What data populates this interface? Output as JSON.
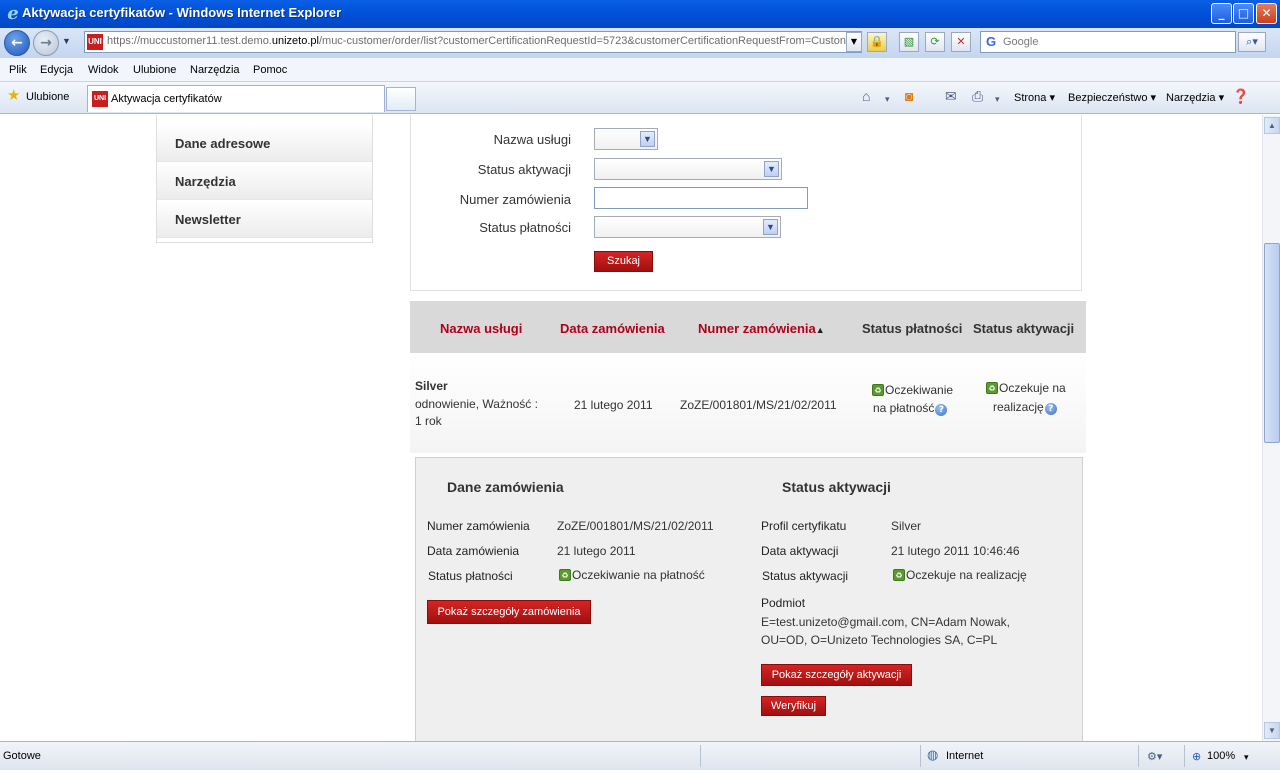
{
  "window": {
    "title": "Aktywacja certyfikatów - Windows Internet Explorer",
    "minimize": "_",
    "maximize": "□",
    "close": "✕"
  },
  "navbar": {
    "back_icon": "←",
    "forward_icon": "→",
    "url_prefix": "https://muccustomer11.test.demo.",
    "url_domain": "unizeto.pl",
    "url_rest": "/muc-customer/order/list?customerCertificationRequestId=5723&customerCertificationRequestFrom=Custon",
    "favicon": "UNI",
    "search_placeholder": "Google",
    "search_logo": "G"
  },
  "menu": [
    "Plik",
    "Edycja",
    "Widok",
    "Ulubione",
    "Narzędzia",
    "Pomoc"
  ],
  "tabs": {
    "favorites": "Ulubione",
    "active_tab": "Aktywacja certyfikatów",
    "commands": [
      "Strona ▾",
      "Bezpieczeństwo ▾",
      "Narzędzia ▾"
    ]
  },
  "sidebar": {
    "items": [
      "Dane adresowe",
      "Narzędzia",
      "Newsletter"
    ]
  },
  "filter": {
    "service_label": "Nazwa usługi",
    "activation_label": "Status aktywacji",
    "order_label": "Numer zamówienia",
    "payment_label": "Status płatności",
    "search_button": "Szukaj"
  },
  "table": {
    "headers": [
      "Nazwa usługi",
      "Data zamówienia",
      "Numer zamówienia",
      "Status płatności",
      "Status aktywacji"
    ],
    "sort_icon": "▲",
    "row": {
      "service_name": "Silver",
      "service_desc1": "odnowienie, Ważność :",
      "service_desc2": "1 rok",
      "order_date": "21 lutego 2011",
      "order_number": "ZoZE/001801/MS/21/02/2011",
      "payment_status1": "Oczekiwanie",
      "payment_status2": "na płatność",
      "activation_status1": "Oczekuje na",
      "activation_status2": "realizację"
    }
  },
  "details": {
    "order_title": "Dane zamówienia",
    "activation_title": "Status aktywacji",
    "order_number_label": "Numer zamówienia",
    "order_number_value": "ZoZE/001801/MS/21/02/2011",
    "order_date_label": "Data zamówienia",
    "order_date_value": "21 lutego 2011",
    "payment_status_label": "Status płatności",
    "payment_status_value": "Oczekiwanie na płatność",
    "show_order_button": "Pokaż szczegóły zamówienia",
    "profile_label": "Profil certyfikatu",
    "profile_value": "Silver",
    "activation_date_label": "Data aktywacji",
    "activation_date_value": "21 lutego 2011 10:46:46",
    "activation_status_label": "Status aktywacji",
    "activation_status_value": "Oczekuje na realizację",
    "subject_label": "Podmiot",
    "subject_line1": "E=test.unizeto@gmail.com, CN=Adam Nowak,",
    "subject_line2": "OU=OD, O=Unizeto Technologies SA, C=PL",
    "show_activation_button": "Pokaż szczegóły aktywacji",
    "verify_button": "Weryfikuj"
  },
  "status": {
    "text": "Gotowe",
    "zone": "Internet",
    "zoom": "100%"
  }
}
